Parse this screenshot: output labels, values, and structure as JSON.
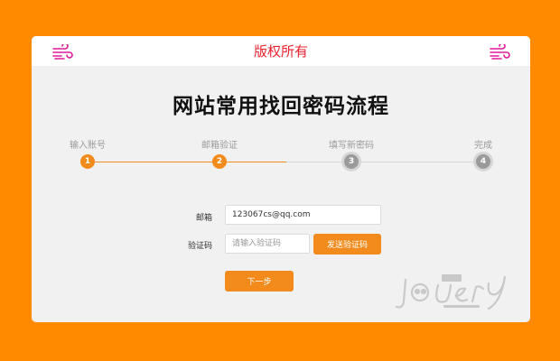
{
  "header": {
    "title": "版权所有"
  },
  "page": {
    "title": "网站常用找回密码流程"
  },
  "steps": [
    {
      "number": "1",
      "label": "输入账号",
      "state": "done"
    },
    {
      "number": "2",
      "label": "邮箱验证",
      "state": "current"
    },
    {
      "number": "3",
      "label": "填写新密码",
      "state": "pending"
    },
    {
      "number": "4",
      "label": "完成",
      "state": "pending"
    }
  ],
  "form": {
    "email_label": "邮箱",
    "email_value": "123067cs@qq.com",
    "code_label": "验证码",
    "code_placeholder": "请输入验证码",
    "send_code_label": "发送验证码",
    "next_label": "下一步"
  },
  "colors": {
    "background": "#ff8a00",
    "accent": "#f28a1c",
    "header_title": "#e8232f",
    "icon": "#e0199b",
    "inactive": "#9a9a9a"
  },
  "icons": {
    "header_left": "wind-icon",
    "header_right": "wind-icon"
  }
}
